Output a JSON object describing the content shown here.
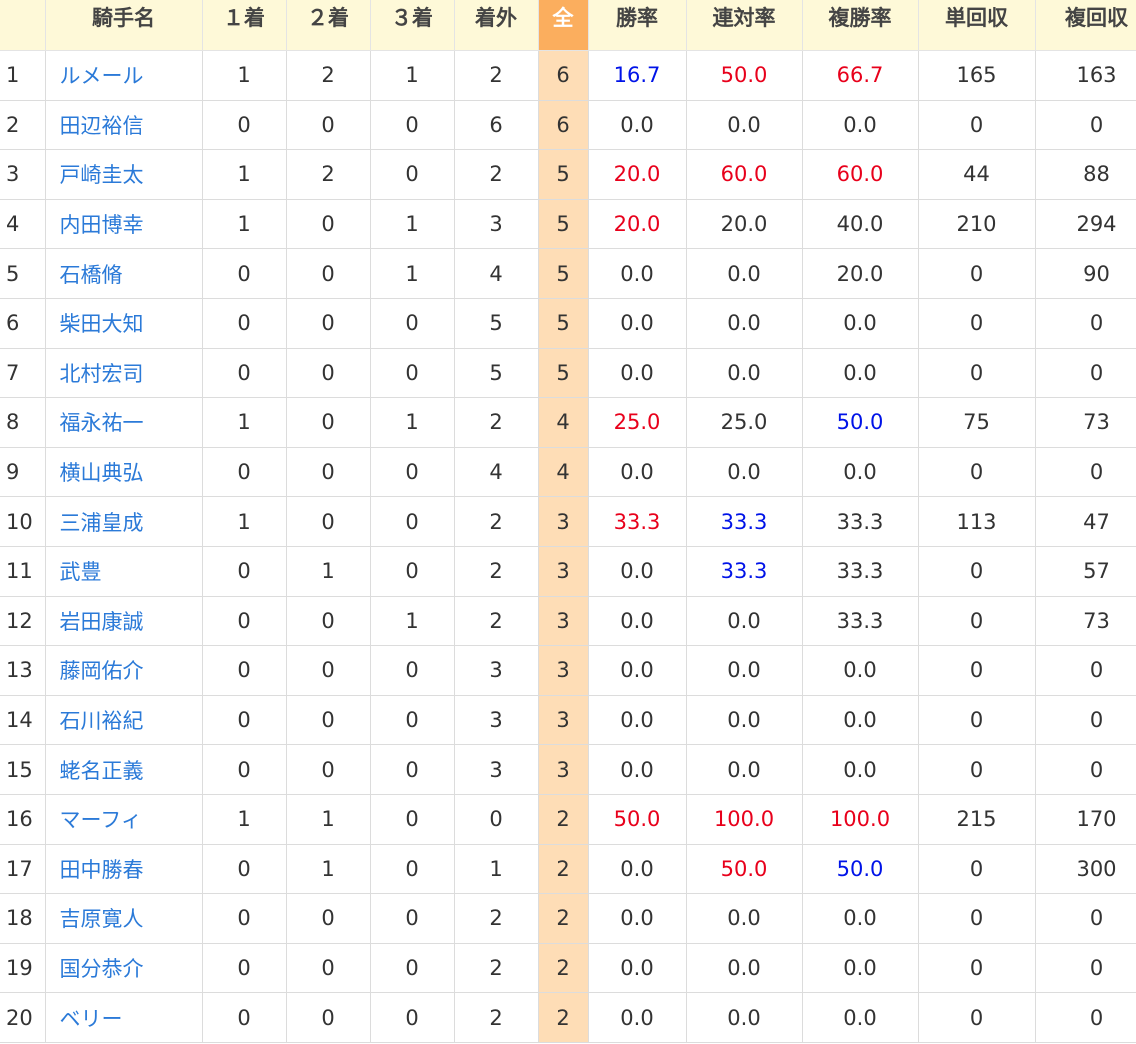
{
  "headers": [
    "",
    "騎手名",
    "１着",
    "２着",
    "３着",
    "着外",
    "全",
    "勝率",
    "連対率",
    "複勝率",
    "単回収",
    "複回収"
  ],
  "colors": {
    "header_bg": "#fef9d8",
    "total_header_bg": "#fbae5e",
    "total_cell_bg": "#feddb6",
    "link": "#2b7ad8",
    "red": "#e8001b",
    "blue": "#0013e8"
  },
  "rows": [
    {
      "rank": "1",
      "name": "ルメール",
      "first": "1",
      "second": "2",
      "third": "1",
      "out": "2",
      "total": "6",
      "win_rate": "16.7",
      "win_color": "blue",
      "place_rate": "50.0",
      "place_color": "red",
      "show_rate": "66.7",
      "show_color": "red",
      "win_return": "165",
      "show_return": "163"
    },
    {
      "rank": "2",
      "name": "田辺裕信",
      "first": "0",
      "second": "0",
      "third": "0",
      "out": "6",
      "total": "6",
      "win_rate": "0.0",
      "win_color": "",
      "place_rate": "0.0",
      "place_color": "",
      "show_rate": "0.0",
      "show_color": "",
      "win_return": "0",
      "show_return": "0"
    },
    {
      "rank": "3",
      "name": "戸崎圭太",
      "first": "1",
      "second": "2",
      "third": "0",
      "out": "2",
      "total": "5",
      "win_rate": "20.0",
      "win_color": "red",
      "place_rate": "60.0",
      "place_color": "red",
      "show_rate": "60.0",
      "show_color": "red",
      "win_return": "44",
      "show_return": "88"
    },
    {
      "rank": "4",
      "name": "内田博幸",
      "first": "1",
      "second": "0",
      "third": "1",
      "out": "3",
      "total": "5",
      "win_rate": "20.0",
      "win_color": "red",
      "place_rate": "20.0",
      "place_color": "",
      "show_rate": "40.0",
      "show_color": "",
      "win_return": "210",
      "show_return": "294"
    },
    {
      "rank": "5",
      "name": "石橋脩",
      "first": "0",
      "second": "0",
      "third": "1",
      "out": "4",
      "total": "5",
      "win_rate": "0.0",
      "win_color": "",
      "place_rate": "0.0",
      "place_color": "",
      "show_rate": "20.0",
      "show_color": "",
      "win_return": "0",
      "show_return": "90"
    },
    {
      "rank": "6",
      "name": "柴田大知",
      "first": "0",
      "second": "0",
      "third": "0",
      "out": "5",
      "total": "5",
      "win_rate": "0.0",
      "win_color": "",
      "place_rate": "0.0",
      "place_color": "",
      "show_rate": "0.0",
      "show_color": "",
      "win_return": "0",
      "show_return": "0"
    },
    {
      "rank": "7",
      "name": "北村宏司",
      "first": "0",
      "second": "0",
      "third": "0",
      "out": "5",
      "total": "5",
      "win_rate": "0.0",
      "win_color": "",
      "place_rate": "0.0",
      "place_color": "",
      "show_rate": "0.0",
      "show_color": "",
      "win_return": "0",
      "show_return": "0"
    },
    {
      "rank": "8",
      "name": "福永祐一",
      "first": "1",
      "second": "0",
      "third": "1",
      "out": "2",
      "total": "4",
      "win_rate": "25.0",
      "win_color": "red",
      "place_rate": "25.0",
      "place_color": "",
      "show_rate": "50.0",
      "show_color": "blue",
      "win_return": "75",
      "show_return": "73"
    },
    {
      "rank": "9",
      "name": "横山典弘",
      "first": "0",
      "second": "0",
      "third": "0",
      "out": "4",
      "total": "4",
      "win_rate": "0.0",
      "win_color": "",
      "place_rate": "0.0",
      "place_color": "",
      "show_rate": "0.0",
      "show_color": "",
      "win_return": "0",
      "show_return": "0"
    },
    {
      "rank": "10",
      "name": "三浦皇成",
      "first": "1",
      "second": "0",
      "third": "0",
      "out": "2",
      "total": "3",
      "win_rate": "33.3",
      "win_color": "red",
      "place_rate": "33.3",
      "place_color": "blue",
      "show_rate": "33.3",
      "show_color": "",
      "win_return": "113",
      "show_return": "47"
    },
    {
      "rank": "11",
      "name": "武豊",
      "first": "0",
      "second": "1",
      "third": "0",
      "out": "2",
      "total": "3",
      "win_rate": "0.0",
      "win_color": "",
      "place_rate": "33.3",
      "place_color": "blue",
      "show_rate": "33.3",
      "show_color": "",
      "win_return": "0",
      "show_return": "57"
    },
    {
      "rank": "12",
      "name": "岩田康誠",
      "first": "0",
      "second": "0",
      "third": "1",
      "out": "2",
      "total": "3",
      "win_rate": "0.0",
      "win_color": "",
      "place_rate": "0.0",
      "place_color": "",
      "show_rate": "33.3",
      "show_color": "",
      "win_return": "0",
      "show_return": "73"
    },
    {
      "rank": "13",
      "name": "藤岡佑介",
      "first": "0",
      "second": "0",
      "third": "0",
      "out": "3",
      "total": "3",
      "win_rate": "0.0",
      "win_color": "",
      "place_rate": "0.0",
      "place_color": "",
      "show_rate": "0.0",
      "show_color": "",
      "win_return": "0",
      "show_return": "0"
    },
    {
      "rank": "14",
      "name": "石川裕紀",
      "first": "0",
      "second": "0",
      "third": "0",
      "out": "3",
      "total": "3",
      "win_rate": "0.0",
      "win_color": "",
      "place_rate": "0.0",
      "place_color": "",
      "show_rate": "0.0",
      "show_color": "",
      "win_return": "0",
      "show_return": "0"
    },
    {
      "rank": "15",
      "name": "蛯名正義",
      "first": "0",
      "second": "0",
      "third": "0",
      "out": "3",
      "total": "3",
      "win_rate": "0.0",
      "win_color": "",
      "place_rate": "0.0",
      "place_color": "",
      "show_rate": "0.0",
      "show_color": "",
      "win_return": "0",
      "show_return": "0"
    },
    {
      "rank": "16",
      "name": "マーフィ",
      "first": "1",
      "second": "1",
      "third": "0",
      "out": "0",
      "total": "2",
      "win_rate": "50.0",
      "win_color": "red",
      "place_rate": "100.0",
      "place_color": "red",
      "show_rate": "100.0",
      "show_color": "red",
      "win_return": "215",
      "show_return": "170"
    },
    {
      "rank": "17",
      "name": "田中勝春",
      "first": "0",
      "second": "1",
      "third": "0",
      "out": "1",
      "total": "2",
      "win_rate": "0.0",
      "win_color": "",
      "place_rate": "50.0",
      "place_color": "red",
      "show_rate": "50.0",
      "show_color": "blue",
      "win_return": "0",
      "show_return": "300"
    },
    {
      "rank": "18",
      "name": "吉原寛人",
      "first": "0",
      "second": "0",
      "third": "0",
      "out": "2",
      "total": "2",
      "win_rate": "0.0",
      "win_color": "",
      "place_rate": "0.0",
      "place_color": "",
      "show_rate": "0.0",
      "show_color": "",
      "win_return": "0",
      "show_return": "0"
    },
    {
      "rank": "19",
      "name": "国分恭介",
      "first": "0",
      "second": "0",
      "third": "0",
      "out": "2",
      "total": "2",
      "win_rate": "0.0",
      "win_color": "",
      "place_rate": "0.0",
      "place_color": "",
      "show_rate": "0.0",
      "show_color": "",
      "win_return": "0",
      "show_return": "0"
    },
    {
      "rank": "20",
      "name": "ベリー",
      "first": "0",
      "second": "0",
      "third": "0",
      "out": "2",
      "total": "2",
      "win_rate": "0.0",
      "win_color": "",
      "place_rate": "0.0",
      "place_color": "",
      "show_rate": "0.0",
      "show_color": "",
      "win_return": "0",
      "show_return": "0"
    }
  ]
}
